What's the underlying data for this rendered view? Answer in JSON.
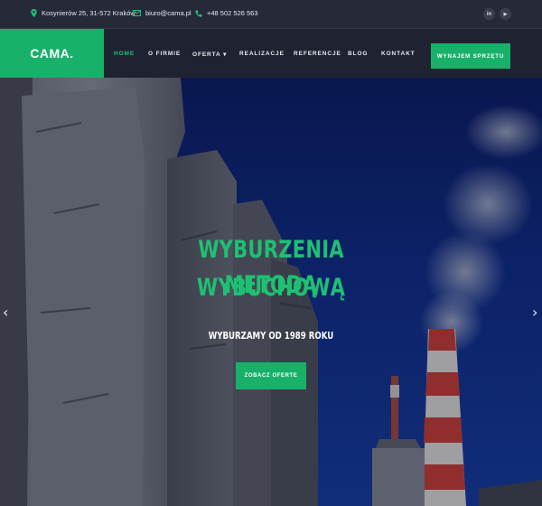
{
  "topbar": {
    "address": "Kosynierów 25, 31-572 Kraków",
    "email": "biuro@cama.pl",
    "phone": "+48 502 526 563",
    "social": [
      {
        "icon": "linkedin-icon",
        "label": "in"
      },
      {
        "icon": "youtube-icon",
        "label": "▶"
      }
    ]
  },
  "nav": {
    "logo": "CAMA.",
    "items": [
      {
        "label": "HOME",
        "active": true
      },
      {
        "label": "O FIRMIE"
      },
      {
        "label": "OFERTA ▾"
      },
      {
        "label": "REALIZACJE"
      },
      {
        "label": "REFERENCJE"
      },
      {
        "label": "BLOG"
      },
      {
        "label": "KONTAKT"
      }
    ],
    "cta": "WYNAJEM SPRZĘTU"
  },
  "hero": {
    "title_line1": "WYBURZENIA METODĄ",
    "title_line2": "WYBUCHOWĄ",
    "subtitle": "WYBURZAMY OD 1989 ROKU",
    "button": "ZOBACZ OFERTE",
    "prev_arrow": "‹",
    "next_arrow": "›"
  },
  "colors": {
    "accent": "#17b16a",
    "title_green": "#1dc173",
    "topbar_bg": "#262a38",
    "nav_bg": "#1f2331",
    "sky": "#0d2a85"
  }
}
